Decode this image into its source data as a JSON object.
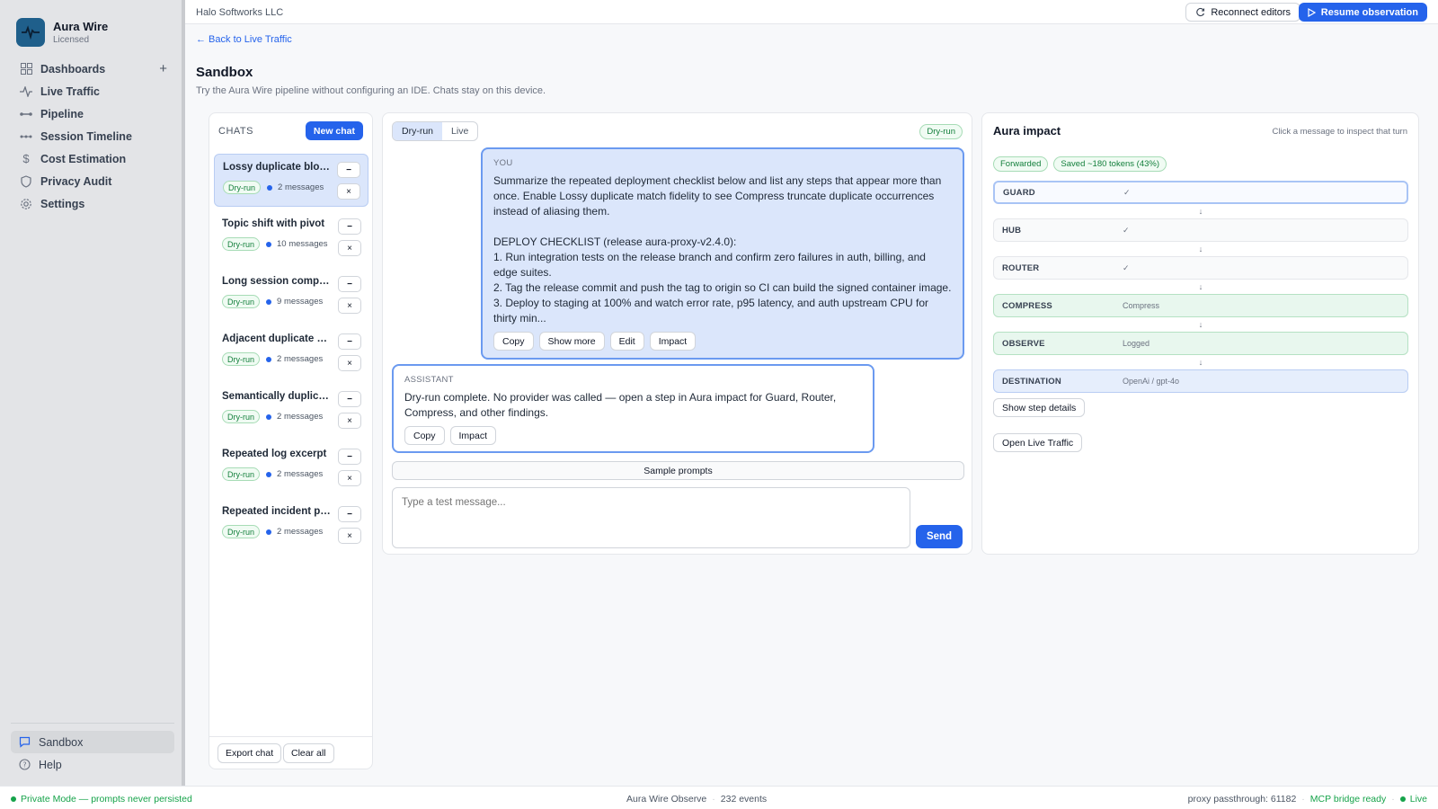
{
  "app": {
    "name": "Aura Wire",
    "license": "Licensed"
  },
  "sidebar": {
    "items": [
      {
        "label": "Dashboards",
        "icon": "grid-icon"
      },
      {
        "label": "Live Traffic",
        "icon": "pulse-icon"
      },
      {
        "label": "Pipeline",
        "icon": "pipeline-icon"
      },
      {
        "label": "Session Timeline",
        "icon": "timeline-icon"
      },
      {
        "label": "Cost Estimation",
        "icon": "dollar-icon"
      },
      {
        "label": "Privacy Audit",
        "icon": "shield-icon"
      },
      {
        "label": "Settings",
        "icon": "gear-icon"
      }
    ],
    "plus": "+",
    "bottom": [
      {
        "label": "Sandbox",
        "icon": "chat-icon"
      },
      {
        "label": "Help",
        "icon": "help-icon"
      }
    ]
  },
  "topbar": {
    "org": "Halo Softworks LLC",
    "reconnect": "Reconnect editors",
    "resume": "Resume observation"
  },
  "page": {
    "back": "← Back to Live Traffic",
    "title": "Sandbox",
    "subtitle": "Try the Aura Wire pipeline without configuring an IDE. Chats stay on this device."
  },
  "chats": {
    "heading": "CHATS",
    "new_chat": "New chat",
    "items": [
      {
        "title": "Lossy duplicate blocks",
        "tag": "Dry-run",
        "count": "2 messages"
      },
      {
        "title": "Topic shift with pivot",
        "tag": "Dry-run",
        "count": "10 messages"
      },
      {
        "title": "Long session compact...",
        "tag": "Dry-run",
        "count": "9 messages"
      },
      {
        "title": "Adjacent duplicate wo...",
        "tag": "Dry-run",
        "count": "2 messages"
      },
      {
        "title": "Semantically duplicat...",
        "tag": "Dry-run",
        "count": "2 messages"
      },
      {
        "title": "Repeated log excerpt",
        "tag": "Dry-run",
        "count": "2 messages"
      },
      {
        "title": "Repeated incident par...",
        "tag": "Dry-run",
        "count": "2 messages"
      }
    ],
    "minimize": "−",
    "close": "×",
    "export": "Export chat",
    "clear": "Clear all"
  },
  "conversation": {
    "mode_dry": "Dry-run",
    "mode_live": "Live",
    "badge": "Dry-run",
    "you_label": "YOU",
    "you_text": "Summarize the repeated deployment checklist below and list any steps that appear more than once. Enable Lossy duplicate match fidelity to see Compress truncate duplicate occurrences instead of aliasing them.\n\nDEPLOY CHECKLIST (release aura-proxy-v2.4.0):\n1. Run integration tests on the release branch and confirm zero failures in auth, billing, and edge suites.\n2. Tag the release commit and push the tag to origin so CI can build the signed container image.\n3. Deploy to staging at 100% and watch error rate, p95 latency, and auth upstream CPU for thirty min...",
    "you_actions": [
      "Copy",
      "Show more",
      "Edit",
      "Impact"
    ],
    "assistant_label": "ASSISTANT",
    "assistant_text": "Dry-run complete. No provider was called — open a step in Aura impact for Guard, Router, Compress, and other findings.",
    "assistant_actions": [
      "Copy",
      "Impact"
    ],
    "sample_prompts": "Sample prompts",
    "input_placeholder": "Type a test message...",
    "send": "Send"
  },
  "impact": {
    "title": "Aura impact",
    "hint": "Click a message to inspect that turn",
    "tags": [
      "Forwarded",
      "Saved ~180 tokens (43%)"
    ],
    "steps": [
      {
        "name": "GUARD",
        "value": "✓"
      },
      {
        "name": "HUB",
        "value": "✓"
      },
      {
        "name": "ROUTER",
        "value": "✓"
      },
      {
        "name": "COMPRESS",
        "value": "Compress"
      },
      {
        "name": "OBSERVE",
        "value": "Logged"
      },
      {
        "name": "DESTINATION",
        "value": "OpenAi / gpt-4o"
      }
    ],
    "arrow": "↓",
    "show_details": "Show step details",
    "open_live": "Open Live Traffic"
  },
  "status": {
    "private": "Private Mode — prompts never persisted",
    "observe": "Aura Wire Observe",
    "events": "232 events",
    "proxy": "proxy passthrough: 61182",
    "mcp": "MCP bridge ready",
    "live": "Live",
    "sep": "·"
  },
  "colors": {
    "accent": "#2563eb",
    "success": "#16a34a",
    "logo_bg": "#1f5f8b"
  }
}
